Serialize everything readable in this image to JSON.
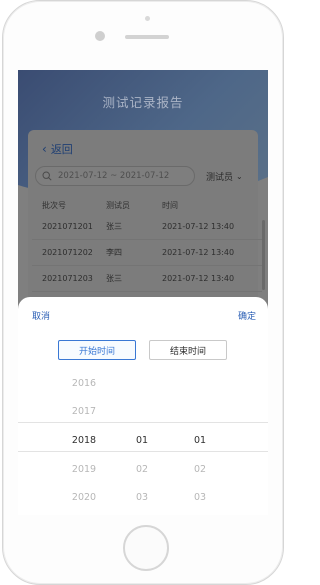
{
  "page_title": "测试记录报告",
  "back_label": "返回",
  "search": {
    "date_range": "2021-07-12 ~ 2021-07-12",
    "icon": "search-icon"
  },
  "tester_filter": {
    "label": "测试员",
    "caret": "⌄"
  },
  "table": {
    "headers": [
      "批次号",
      "测试员",
      "时间"
    ],
    "rows": [
      [
        "2021071201",
        "张三",
        "2021-07-12 13:40"
      ],
      [
        "2021071202",
        "李四",
        "2021-07-12 13:40"
      ],
      [
        "2021071203",
        "张三",
        "2021-07-12 13:40"
      ]
    ]
  },
  "sheet": {
    "cancel_label": "取消",
    "confirm_label": "确定",
    "segments": {
      "start": "开始时间",
      "end": "结束时间"
    },
    "picker": {
      "years": [
        "2016",
        "2017",
        "2018",
        "2019",
        "2020"
      ],
      "months": [
        "",
        "",
        "01",
        "02",
        "03"
      ],
      "days": [
        "",
        "",
        "01",
        "02",
        "03"
      ],
      "selected": {
        "year": "2018",
        "month": "01",
        "day": "01"
      }
    }
  },
  "colors": {
    "accent": "#3a78d4",
    "link": "#2b5fb5",
    "header": "#3a4c72"
  }
}
